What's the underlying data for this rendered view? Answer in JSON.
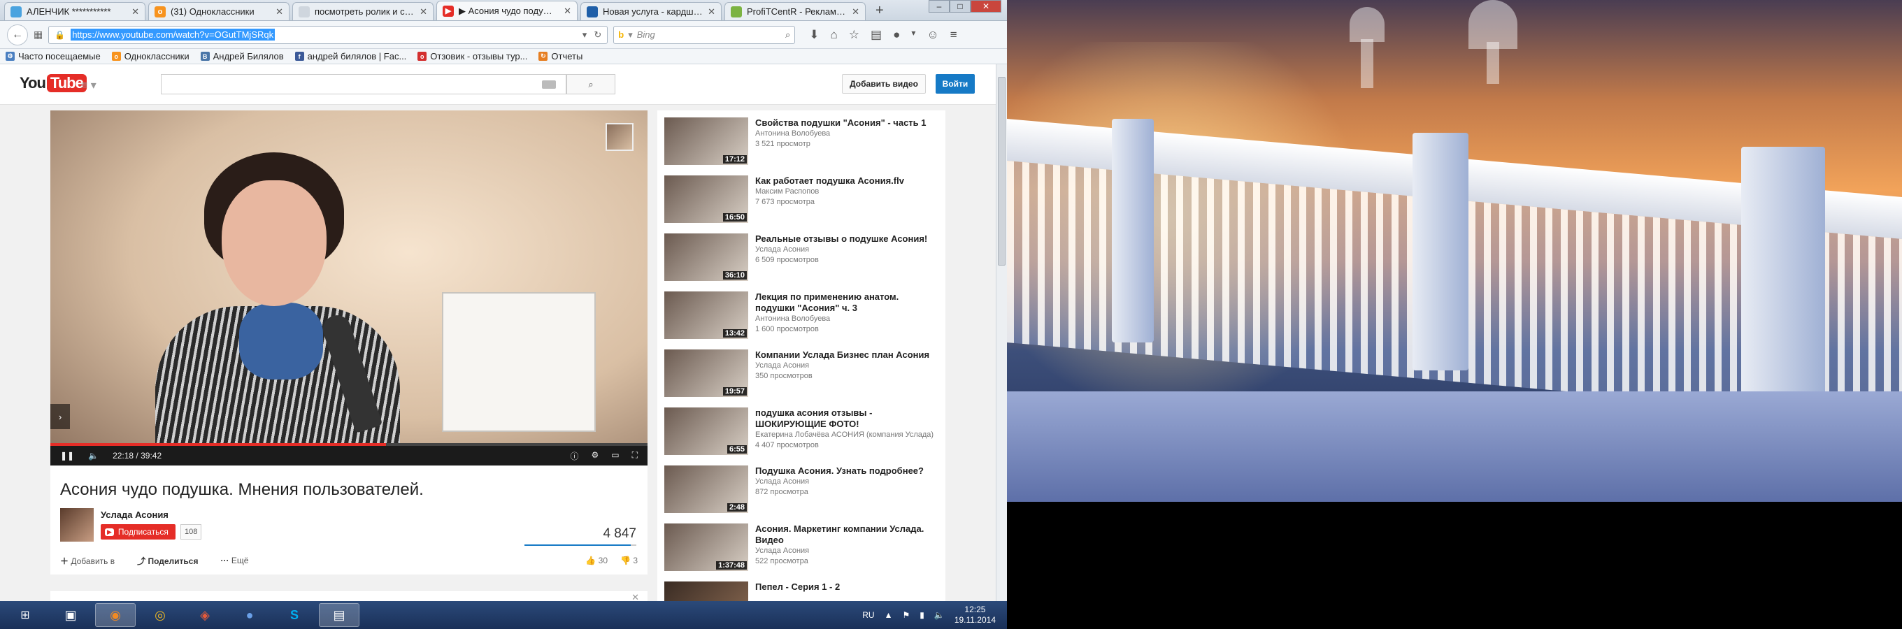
{
  "browser": {
    "tabs": [
      {
        "title": "АЛЕНЧИК ***********",
        "favicon_color": "#4aa3df",
        "active": false
      },
      {
        "title": "(31) Одноклассники",
        "favicon_color": "#f7931e",
        "active": false
      },
      {
        "title": "посмотреть ролик и сдел...",
        "favicon_color": "#cfd6de",
        "active": false
      },
      {
        "title": "▶ Асония чудо подушка...",
        "favicon_color": "#e52d27",
        "active": true
      },
      {
        "title": "Новая услуга - кардшари...",
        "favicon_color": "#1f5fa8",
        "active": false
      },
      {
        "title": "ProfiTCentR - Рекламное ...",
        "favicon_color": "#7cb342",
        "active": false
      }
    ],
    "url": "https://www.youtube.com/watch?v=OGutTMjSRqk",
    "search_engine": "Bing",
    "bookmarks": [
      {
        "label": "Часто посещаемые",
        "color": "#4a7fc1"
      },
      {
        "label": "Одноклассники",
        "color": "#f7931e"
      },
      {
        "label": "Андрей Билялов",
        "color": "#4a76a8"
      },
      {
        "label": "андрей билялов | Fac...",
        "color": "#3b5998"
      },
      {
        "label": "Отзовик - отзывы тур...",
        "color": "#d32f2f"
      },
      {
        "label": "Отчеты",
        "color": "#e67e22"
      }
    ]
  },
  "youtube": {
    "logo_you": "You",
    "logo_tube": "Tube",
    "search_button_icon": "search-icon",
    "upload_label": "Добавить видео",
    "signin_label": "Войти",
    "player": {
      "current_time": "22:18",
      "separator": " / ",
      "duration": "39:42",
      "progress": 0.562
    },
    "video": {
      "title": "Асония чудо подушка. Мнения пользователей.",
      "channel": "Услада Асония",
      "subscribe_label": "Подписаться",
      "subscriber_count": "108",
      "views": "4 847",
      "add_to_label": "Добавить в",
      "share_label": "Поделиться",
      "more_label": "Ещё",
      "likes": "30",
      "dislikes": "3"
    },
    "related": [
      {
        "title": "Свойства подушки \"Асония\" - часть 1",
        "channel": "Антонина Волобуева",
        "views": "3 521 просмотр",
        "duration": "17:12"
      },
      {
        "title": "Как работает подушка Асония.flv",
        "channel": "Максим Распопов",
        "views": "7 673 просмотра",
        "duration": "16:50"
      },
      {
        "title": "Реальные отзывы о подушке Асония!",
        "channel": "Услада Асония",
        "views": "6 509 просмотров",
        "duration": "36:10"
      },
      {
        "title": "Лекция по применению анатом. подушки \"Асония\" ч. 3",
        "channel": "Антонина Волобуева",
        "views": "1 600 просмотров",
        "duration": "13:42"
      },
      {
        "title": "Компании Услада Бизнес план Асония",
        "channel": "Услада Асония",
        "views": "350 просмотров",
        "duration": "19:57"
      },
      {
        "title": "подушка асония отзывы - ШОКИРУЮЩИЕ ФОТО!",
        "channel": "Екатерина Лобачёва АСОНИЯ (компания Услада)",
        "views": "4 407 просмотров",
        "duration": "6:55"
      },
      {
        "title": "Подушка Асония. Узнать подробнее?",
        "channel": "Услада Асония",
        "views": "872 просмотра",
        "duration": "2:48"
      },
      {
        "title": "Асония. Маркетинг компании Услада. Видео",
        "channel": "Услада Асония",
        "views": "522 просмотра",
        "duration": "1:37:48"
      },
      {
        "title": "Пепел - Серия 1 - 2",
        "channel": "",
        "views": "",
        "duration": ""
      }
    ]
  },
  "taskbar": {
    "language": "RU",
    "time": "12:25",
    "date": "19.11.2014"
  }
}
